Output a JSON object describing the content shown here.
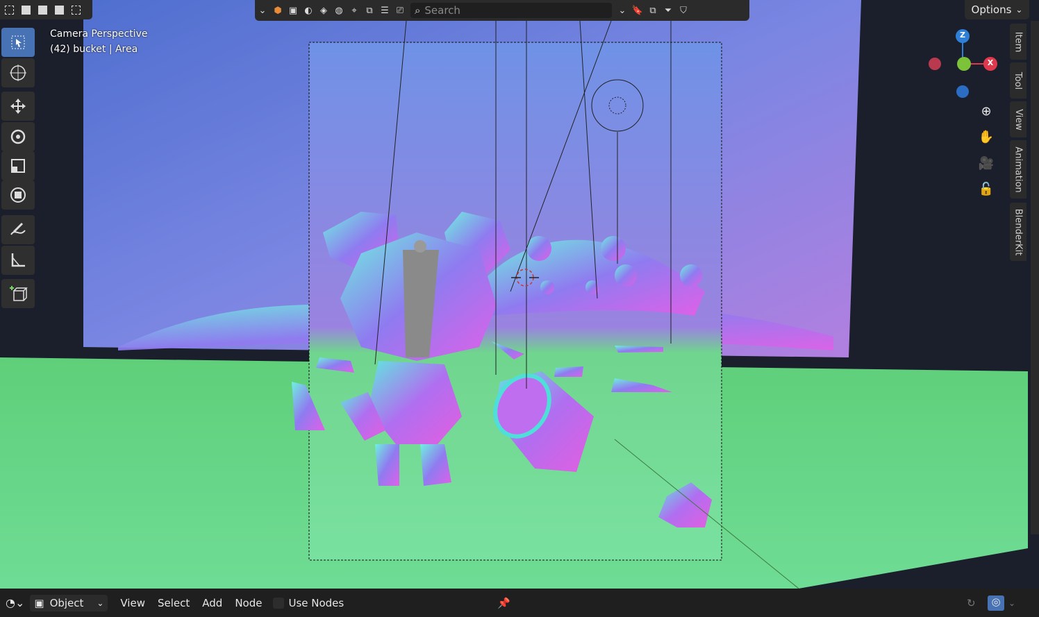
{
  "header": {
    "search_placeholder": "Search",
    "options_label": "Options"
  },
  "viewport": {
    "view_name": "Camera Perspective",
    "object_info_prefix": "(42) bucket",
    "object_info_suffix": "Area",
    "gizmo": {
      "z_label": "Z",
      "x_label": "X"
    },
    "colors": {
      "sky_top": "#5a7bd8",
      "sky_bottom": "#a27be0",
      "ground": "#6fdc8a",
      "gizmo_x": "#e0394d",
      "gizmo_y": "#7cc33a",
      "gizmo_z": "#2f7fd6",
      "active_tool": "#4772b3"
    }
  },
  "toolbar": {
    "tools": [
      {
        "name": "select-box-icon",
        "active": true
      },
      {
        "name": "cursor-icon",
        "active": false
      },
      {
        "name": "move-icon",
        "active": false
      },
      {
        "name": "rotate-icon",
        "active": false
      },
      {
        "name": "scale-icon",
        "active": false
      },
      {
        "name": "transform-icon",
        "active": false
      },
      {
        "name": "annotate-icon",
        "active": false
      },
      {
        "name": "measure-icon",
        "active": false
      },
      {
        "name": "add-cube-icon",
        "active": false
      }
    ]
  },
  "sidebar_tabs": [
    "Item",
    "Tool",
    "View",
    "Animation",
    "BlenderKit"
  ],
  "bottom_bar": {
    "mode_label": "Object",
    "menus": [
      "View",
      "Select",
      "Add",
      "Node"
    ],
    "use_nodes_label": "Use Nodes"
  }
}
